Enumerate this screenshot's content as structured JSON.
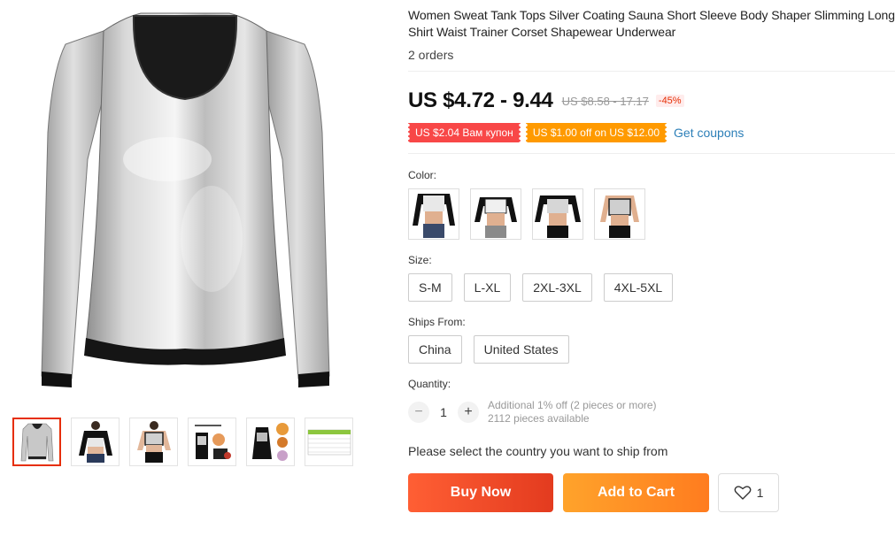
{
  "product": {
    "title": "Women Sweat Tank Tops Silver Coating Sauna Short Sleeve Body Shaper Slimming Long Shirt Waist Trainer Corset Shapewear Underwear",
    "orders": "2 orders",
    "price": "US $4.72 - 9.44",
    "old_price": "US $8.58 - 17.17",
    "discount": "-45%"
  },
  "coupons": {
    "coupon1": "US $2.04 Вам купон",
    "coupon2": "US $1.00 off on US $12.00",
    "get_coupons": "Get coupons"
  },
  "color": {
    "label": "Color:",
    "swatches": [
      "silver-white-top",
      "silver-black-top",
      "silver-black-crop",
      "silver-vest"
    ]
  },
  "size": {
    "label": "Size:",
    "options": [
      "S-M",
      "L-XL",
      "2XL-3XL",
      "4XL-5XL"
    ]
  },
  "ships": {
    "label": "Ships From:",
    "options": [
      "China",
      "United States"
    ]
  },
  "quantity": {
    "label": "Quantity:",
    "minus": "−",
    "value": "1",
    "plus": "+",
    "additional": "Additional 1% off (2 pieces or more)",
    "available": "2112 pieces available"
  },
  "ship_message": "Please select the country you want to ship from",
  "actions": {
    "buy_now": "Buy Now",
    "add_to_cart": "Add to Cart",
    "wish_count": "1"
  },
  "colors": {
    "accent": "#e62e04",
    "coupon_red": "#f84747",
    "coupon_orange": "#ff9a00",
    "link": "#2c7fb8"
  }
}
